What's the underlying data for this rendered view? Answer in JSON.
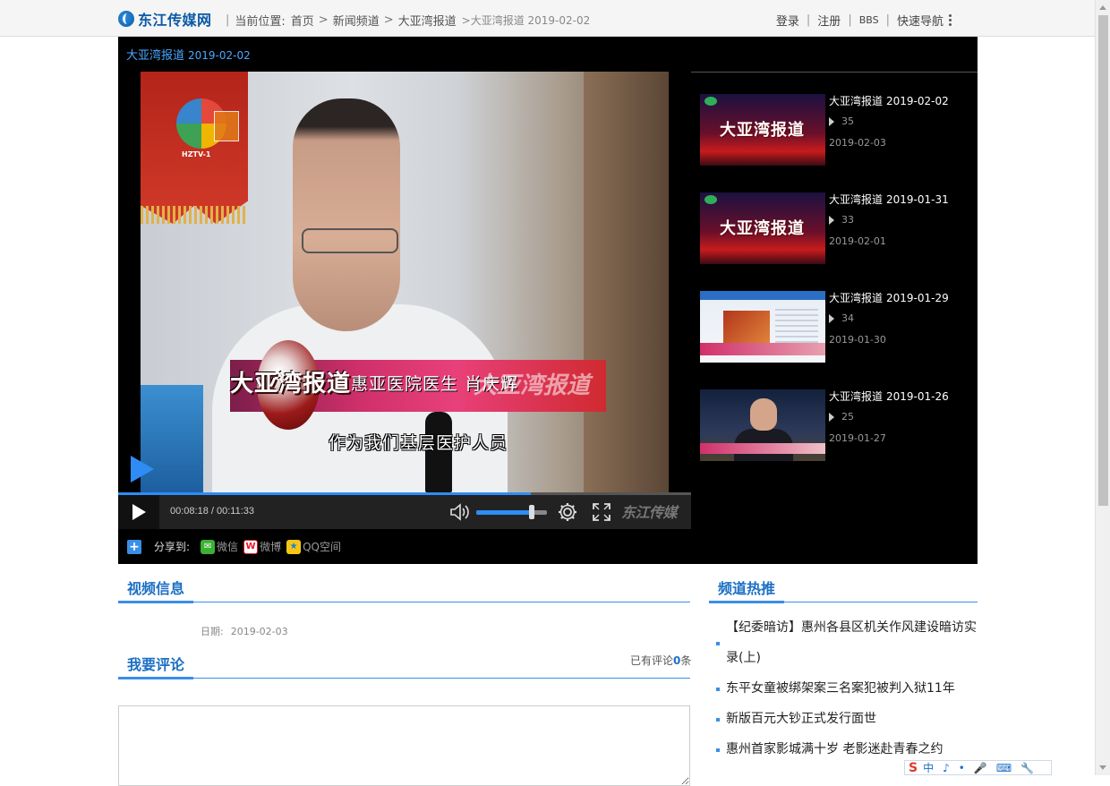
{
  "site": {
    "logo": "东江传媒网"
  },
  "breadcrumb": {
    "prefix": "当前位置:",
    "items": [
      "首页",
      "新闻频道",
      "大亚湾报道"
    ],
    "current": ">大亚湾报道 2019-02-02"
  },
  "top_links": {
    "login": "登录",
    "register": "注册",
    "bbs": "BBS",
    "quick_nav": "快速导航"
  },
  "player": {
    "title": "大亚湾报道",
    "title_date": "2019-02-02",
    "overlay": {
      "show_name": "大亚湾报道",
      "speaker": "惠亚医院医生  肖庆辉",
      "subtitle": "作为我们基层医护人员",
      "tv_logo": "HZTV-1",
      "watermark": "大亚湾报道"
    },
    "time": "00:08:18 / 00:11:33",
    "progress": 0.72,
    "volume": 0.78,
    "brand": "东江传媒"
  },
  "share": {
    "label": "分享到:",
    "wechat": "微信",
    "weibo": "微博",
    "qzone": "QQ空间"
  },
  "playlist": [
    {
      "title": "大亚湾报道",
      "date": "2019-02-02",
      "views": "35",
      "pub": "2019-02-03",
      "thumb_text": "大亚湾报道"
    },
    {
      "title": "大亚湾报道",
      "date": "2019-01-31",
      "views": "33",
      "pub": "2019-02-01",
      "thumb_text": "大亚湾报道"
    },
    {
      "title": "大亚湾报道",
      "date": "2019-01-29",
      "views": "34",
      "pub": "2019-01-30",
      "thumb_text": ""
    },
    {
      "title": "大亚湾报道",
      "date": "2019-01-26",
      "views": "25",
      "pub": "2019-01-27",
      "thumb_text": ""
    }
  ],
  "video_info": {
    "heading": "视频信息",
    "date_label": "日期:",
    "date": "2019-02-03"
  },
  "comments": {
    "heading": "我要评论",
    "count_prefix": "已有评论",
    "count": "0",
    "count_suffix": "条"
  },
  "hot": {
    "heading": "频道热推",
    "items": [
      "【纪委暗访】惠州各县区机关作风建设暗访实录(上)",
      "东平女童被绑架案三名案犯被判入狱11年",
      "新版百元大钞正式发行面世",
      "惠州首家影城满十岁 老影迷赴青春之约"
    ]
  },
  "ime": {
    "mode": "中"
  }
}
